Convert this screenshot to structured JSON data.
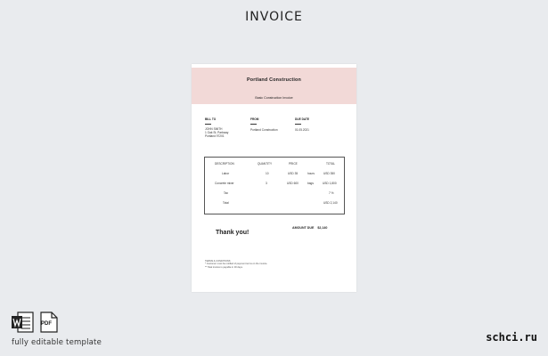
{
  "headline": "INVOICE",
  "invoice": {
    "company": "Portland Construction",
    "doc_title": "Basic Construction Invoice",
    "bill_to": {
      "label": "BILL TO",
      "line1": "JOHN SMITH",
      "line2": "1 Oak St. Parkway",
      "line3": "Portland 97201"
    },
    "from": {
      "label": "FROM",
      "name": "Portland Construction"
    },
    "due_date": {
      "label": "DUE DATE",
      "value": "01.05.2021"
    },
    "table": {
      "headers": {
        "description": "DESCRIPTION",
        "quantity": "QUANTITY",
        "price": "PRICE",
        "total": "TOTAL"
      },
      "rows": [
        {
          "description": "Labor",
          "quantity": "10",
          "price": "USD 35",
          "unit": "hours",
          "total": "USD 350"
        },
        {
          "description": "Concrete mixer",
          "quantity": "3",
          "price": "USD 600",
          "unit": "bags",
          "total": "USD 1,800"
        },
        {
          "description": "Tax",
          "quantity": "",
          "price": "",
          "unit": "",
          "total": "7 %"
        },
        {
          "description": "Total",
          "quantity": "",
          "price": "",
          "unit": "",
          "total": "USD 2,140"
        }
      ]
    },
    "amount_due_label": "AMOUNT DUE",
    "amount_due_value": "$2,140",
    "thanks": "Thank you!",
    "terms_title": "TERMS & CONDITIONS",
    "terms": [
      "* Customer must be notified of payment terms on the invoice.",
      "** Total invoice is payable in 30 days."
    ]
  },
  "footer": {
    "word_icon": "word-document-icon",
    "pdf_icon": "pdf-document-icon",
    "pdf_badge": "PDF",
    "caption": "fully editable template",
    "site": "schci.ru"
  }
}
